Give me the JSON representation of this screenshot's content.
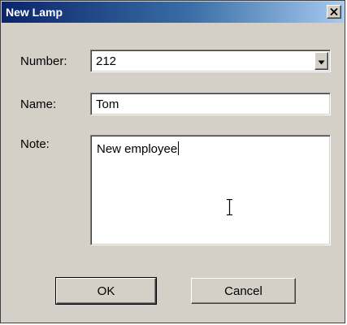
{
  "window": {
    "title": "New Lamp"
  },
  "form": {
    "number_label": "Number:",
    "number_value": "212",
    "name_label": "Name:",
    "name_value": "Tom",
    "note_label": "Note:",
    "note_value": "New employee"
  },
  "buttons": {
    "ok_label": "OK",
    "cancel_label": "Cancel"
  },
  "icons": {
    "close": "close-icon",
    "dropdown": "chevron-down-icon",
    "cursor": "text-cursor-icon"
  },
  "colors": {
    "titlebar_start": "#0a246a",
    "titlebar_end": "#a6caf0",
    "dialog_face": "#d4d0c8"
  }
}
